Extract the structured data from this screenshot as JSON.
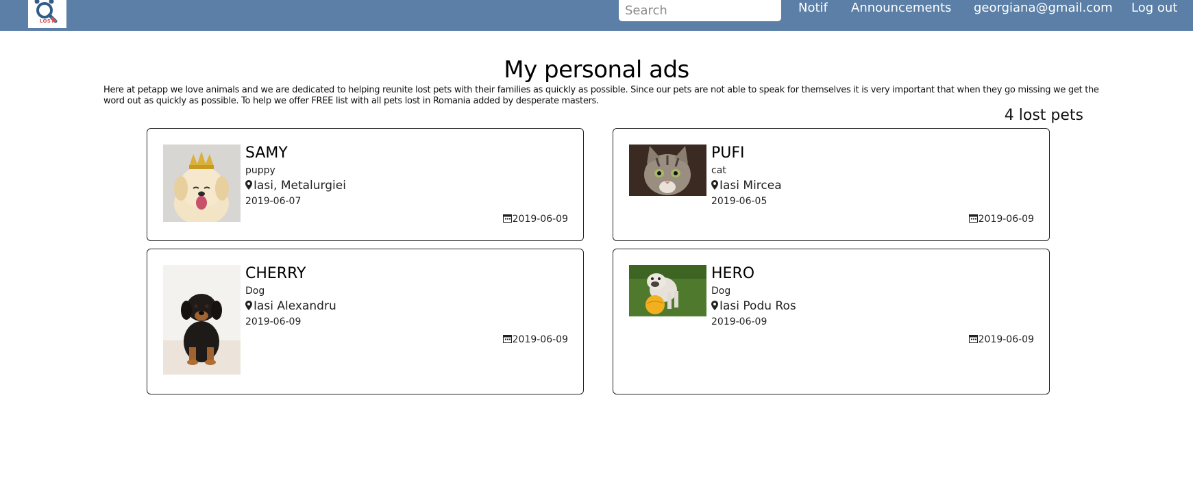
{
  "nav": {
    "logo_text": "LOST",
    "search_placeholder": "Search",
    "notif": "Notif",
    "announcements": "Announcements",
    "user_email": "georgiana@gmail.com",
    "logout": "Log out",
    "bar_color": "#5b7fa6"
  },
  "page": {
    "title": "My personal ads",
    "intro": "Here at petapp we love animals and we are dedicated to helping reunite lost pets with their families as quickly as possible. Since our pets are not able to speak for themselves it is very important that when they go missing we get the word out as quickly as possible. To help we offer FREE list with all pets lost in Romania added by desperate masters.",
    "count": "4 lost pets"
  },
  "ads": [
    {
      "name": "SAMY",
      "species": "puppy",
      "location": "Iasi, Metalurgiei",
      "lost_date": "2019-06-07",
      "posted_date": "2019-06-09"
    },
    {
      "name": "PUFI",
      "species": "cat",
      "location": "Iasi Mircea",
      "lost_date": "2019-06-05",
      "posted_date": "2019-06-09"
    },
    {
      "name": "CHERRY",
      "species": "Dog",
      "location": "Iasi Alexandru",
      "lost_date": "2019-06-09",
      "posted_date": "2019-06-09"
    },
    {
      "name": "HERO",
      "species": "Dog",
      "location": "Iasi Podu Ros",
      "lost_date": "2019-06-09",
      "posted_date": "2019-06-09"
    }
  ]
}
